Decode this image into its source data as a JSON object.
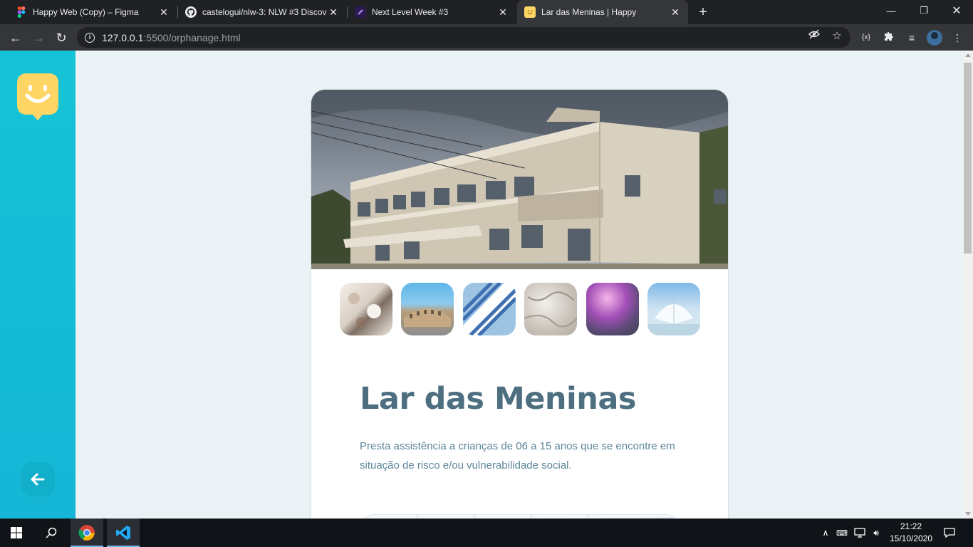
{
  "browser": {
    "tabs": [
      {
        "title": "Happy Web (Copy) – Figma",
        "icon": "figma-icon"
      },
      {
        "title": "castelogui/nlw-3: NLW #3 Discov",
        "icon": "github-icon"
      },
      {
        "title": "Next Level Week #3",
        "icon": "rocketseat-icon"
      },
      {
        "title": "Lar das Meninas | Happy",
        "icon": "happy-icon",
        "active": true
      }
    ],
    "close_glyph": "✕",
    "url_host": "127.0.0.1",
    "url_path": ":5500/orphanage.html"
  },
  "page": {
    "title": "Lar das Meninas",
    "description": "Presta assistência a crianças de 06 a 15 anos que se encontre em situação de risco e/ou vulnerabilidade social.",
    "accent_color": "#15c3d6",
    "title_color": "#4d6f80",
    "text_color": "#5c8599",
    "gallery": [
      "beach-flatlay",
      "colosseum",
      "umbrella",
      "marble",
      "purple-smoke",
      "modern-building"
    ]
  },
  "taskbar": {
    "time": "21:22",
    "date": "15/10/2020",
    "apps": [
      "chrome-icon",
      "vscode-icon"
    ]
  }
}
